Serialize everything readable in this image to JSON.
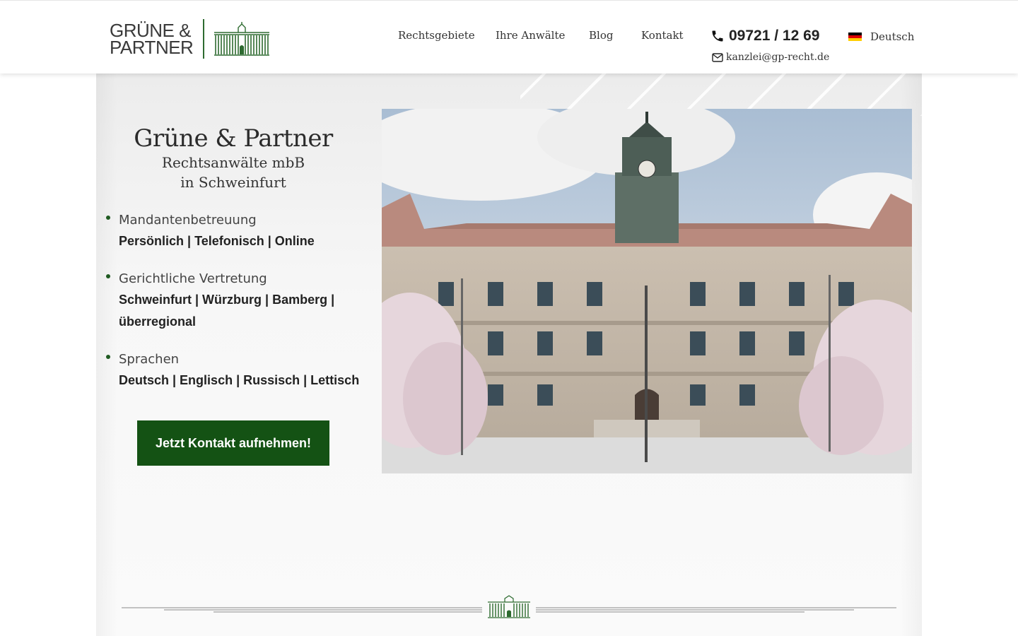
{
  "header": {
    "logo": {
      "line1": "GRÜNE &",
      "line2": "PARTNER"
    },
    "nav": [
      {
        "label": "Rechtsgebiete"
      },
      {
        "label": "Ihre Anwälte"
      },
      {
        "label": "Blog"
      },
      {
        "label": "Kontakt"
      }
    ],
    "phone": "09721 / 12 69",
    "email": "kanzlei@gp-recht.de",
    "language": "Deutsch"
  },
  "hero": {
    "title": "Grüne & Partner",
    "subtitle1": "Rechtsanwälte mbB",
    "subtitle2": "in Schweinfurt",
    "bullets": [
      {
        "title": "Mandantenbetreuung",
        "text": "Persönlich | Telefonisch | Online"
      },
      {
        "title": "Gerichtliche Vertretung",
        "text": "Schweinfurt | Würzburg | Bamberg | überregional"
      },
      {
        "title": "Sprachen",
        "text": "Deutsch | Englisch | Russisch | Lettisch"
      }
    ],
    "cta_label": "Jetzt Kontakt aufnehmen!"
  },
  "colors": {
    "brand_green": "#145214",
    "accent_green": "#2e6b30"
  },
  "icons": {
    "phone": "phone-icon",
    "email": "envelope-icon",
    "flag": "german-flag-icon"
  }
}
